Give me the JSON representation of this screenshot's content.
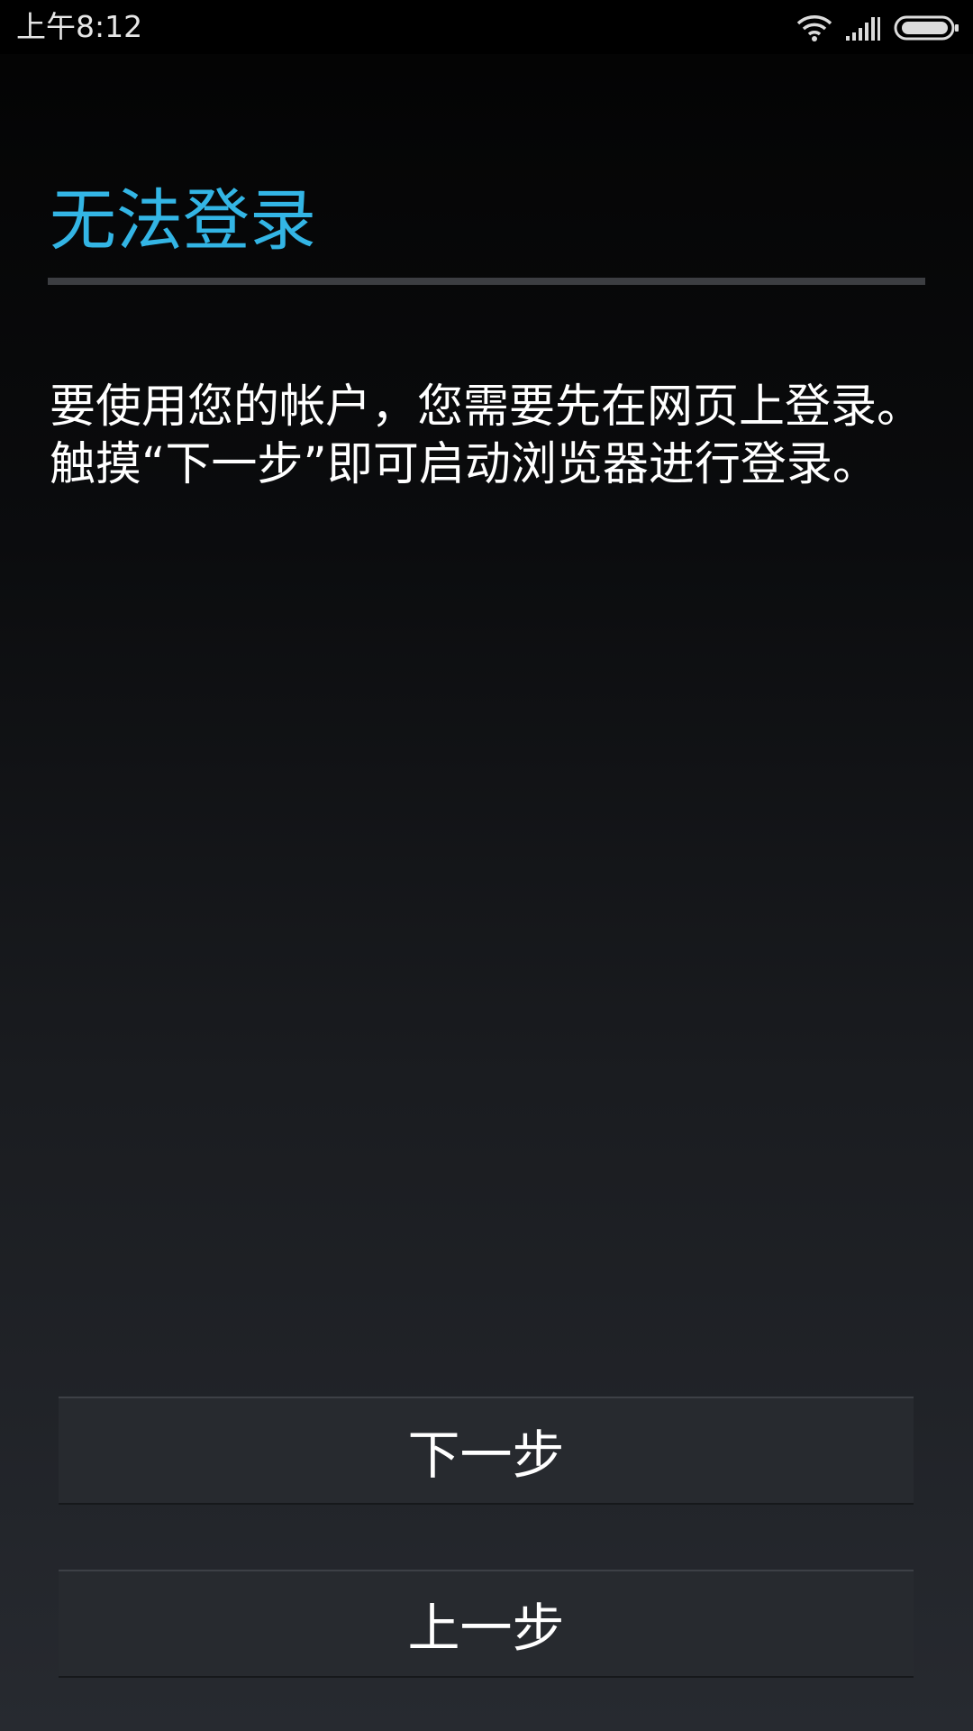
{
  "status_bar": {
    "time": "上午8:12",
    "icons": [
      "wifi-icon",
      "signal-icon",
      "battery-icon"
    ]
  },
  "dialog": {
    "title": "无法登录",
    "message": "要使用您的帐户，您需要先在网页上登录。触摸“下一步”即可启动浏览器进行登录。"
  },
  "buttons": {
    "next_label": "下一步",
    "back_label": "上一步"
  },
  "colors": {
    "accent": "#33b5e5",
    "button_bg": "#272a2f"
  }
}
